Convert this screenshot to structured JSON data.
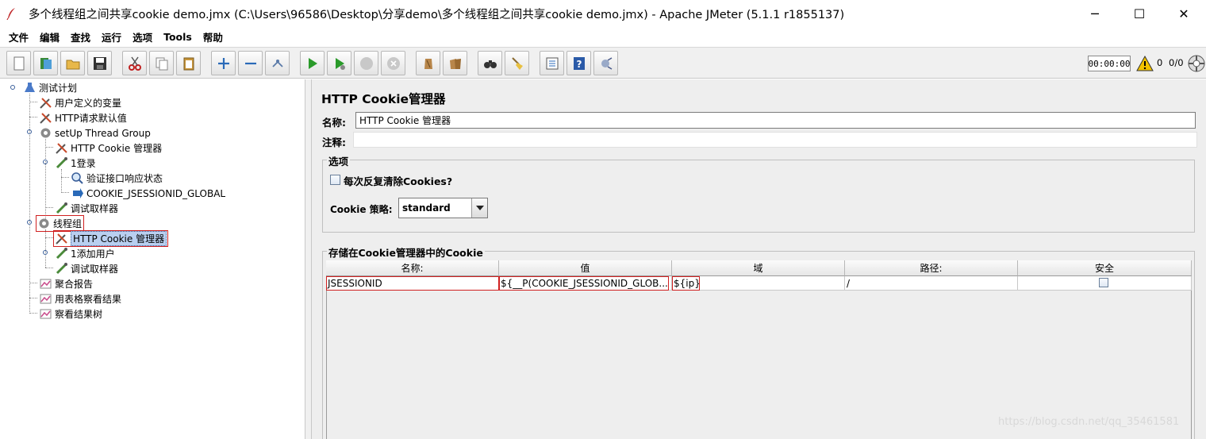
{
  "window": {
    "title": "多个线程组之间共享cookie demo.jmx (C:\\Users\\96586\\Desktop\\分享demo\\多个线程组之间共享cookie demo.jmx) - Apache JMeter (5.1.1 r1855137)",
    "minimize": "─",
    "maximize": "☐",
    "close": "✕"
  },
  "menu": [
    "文件",
    "编辑",
    "查找",
    "运行",
    "选项",
    "Tools",
    "帮助"
  ],
  "toolbar": {
    "icons": [
      "new-icon",
      "templates-icon",
      "open-icon",
      "save-icon",
      "cut-icon",
      "copy-icon",
      "paste-icon",
      "expand-icon",
      "collapse-icon",
      "toggle-icon",
      "start-icon",
      "start-no-pause-icon",
      "stop-icon",
      "shutdown-icon",
      "clear-icon",
      "clear-all-icon",
      "search-icon",
      "reset-search-icon",
      "function-helper-icon",
      "help-icon",
      "remote-icon"
    ],
    "timer": "00:00:00",
    "warnings": "0",
    "threads": "0/0"
  },
  "tree": {
    "root": "测试计划",
    "n1": "用户定义的变量",
    "n2": "HTTP请求默认值",
    "n3": "setUp Thread Group",
    "n3a": "HTTP Cookie 管理器",
    "n3b": "1登录",
    "n3b1": "验证接口响应状态",
    "n3b2": "COOKIE_JSESSIONID_GLOBAL",
    "n3c": "调试取样器",
    "n4": "线程组",
    "n4a": "HTTP Cookie 管理器",
    "n4b": "1添加用户",
    "n4c": "调试取样器",
    "n5": "聚合报告",
    "n6": "用表格察看结果",
    "n7": "察看结果树"
  },
  "panel": {
    "title": "HTTP Cookie管理器",
    "name_label": "名称:",
    "name_value": "HTTP Cookie 管理器",
    "comment_label": "注释:",
    "options_legend": "选项",
    "clear_each_iteration": "每次反复清除Cookies?",
    "policy_label": "Cookie 策略:",
    "policy_value": "standard",
    "stored_legend": "存储在Cookie管理器中的Cookie"
  },
  "cookie_table": {
    "headers": [
      "名称:",
      "值",
      "域",
      "路径:",
      "安全"
    ],
    "rows": [
      {
        "name": "JSESSIONID",
        "value": "${__P(COOKIE_JSESSIONID_GLOB...",
        "domain": "${ip}",
        "path": "/",
        "secure": false
      }
    ]
  },
  "watermark": "https://blog.csdn.net/qq_35461581"
}
